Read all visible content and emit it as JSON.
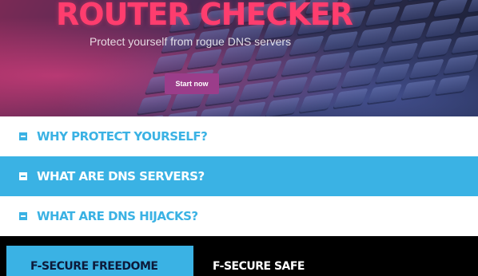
{
  "hero": {
    "title": "ROUTER CHECKER",
    "subtitle": "Protect yourself from rogue DNS servers",
    "cta_label": "Start now"
  },
  "accordion": [
    {
      "label": "WHY PROTECT YOURSELF?"
    },
    {
      "label": "WHAT ARE DNS SERVERS?"
    },
    {
      "label": "WHAT ARE DNS HIJACKS?"
    }
  ],
  "tabs": [
    {
      "label": "F-SECURE FREEDOME",
      "active": true
    },
    {
      "label": "F-SECURE SAFE",
      "active": false
    }
  ],
  "colors": {
    "accent": "#3ab2e4",
    "title": "#ff3d6e",
    "button": "#9b3d8a"
  }
}
